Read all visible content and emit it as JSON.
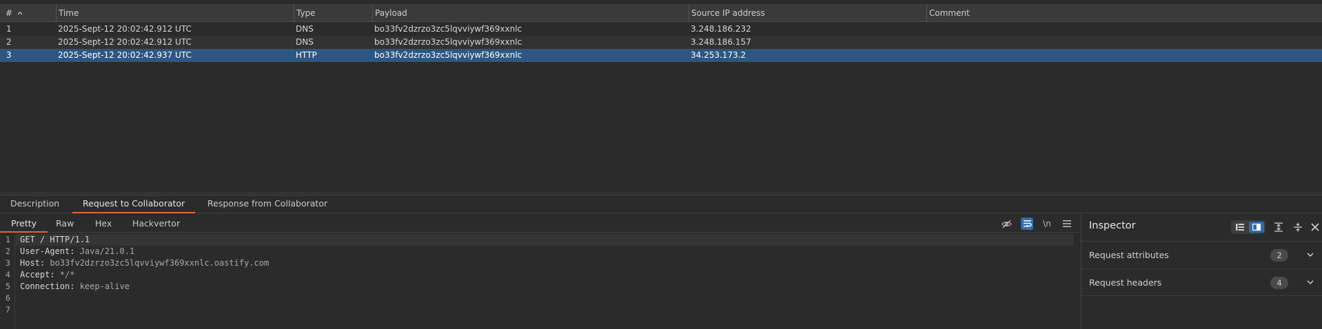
{
  "table": {
    "columns": [
      "#",
      "Time",
      "Type",
      "Payload",
      "Source IP address",
      "Comment"
    ],
    "rows": [
      {
        "num": "1",
        "time": "2025-Sept-12 20:02:42.912 UTC",
        "type": "DNS",
        "payload": "bo33fv2dzrzo3zc5lqvviywf369xxnlc",
        "ip": "3.248.186.232",
        "comment": ""
      },
      {
        "num": "2",
        "time": "2025-Sept-12 20:02:42.912 UTC",
        "type": "DNS",
        "payload": "bo33fv2dzrzo3zc5lqvviywf369xxnlc",
        "ip": "3.248.186.157",
        "comment": ""
      },
      {
        "num": "3",
        "time": "2025-Sept-12 20:02:42.937 UTC",
        "type": "HTTP",
        "payload": "bo33fv2dzrzo3zc5lqvviywf369xxnlc",
        "ip": "34.253.173.2",
        "comment": ""
      }
    ],
    "selected_row": "3"
  },
  "main_tabs": [
    "Description",
    "Request to Collaborator",
    "Response from Collaborator"
  ],
  "editor": {
    "tabs": [
      "Pretty",
      "Raw",
      "Hex",
      "Hackvertor"
    ],
    "newline_label": "\\n",
    "line_numbers": [
      "1",
      "2",
      "3",
      "4",
      "5",
      "6",
      "7"
    ],
    "lines": [
      {
        "key": "GET / HTTP/1.1",
        "value": ""
      },
      {
        "key": "User-Agent:",
        "value": " Java/21.0.1"
      },
      {
        "key": "Host:",
        "value": " bo33fv2dzrzo3zc5lqvviywf369xxnlc.oastify.com"
      },
      {
        "key": "Accept:",
        "value": " */*"
      },
      {
        "key": "Connection:",
        "value": " keep-alive"
      },
      {
        "key": "",
        "value": ""
      },
      {
        "key": "",
        "value": ""
      }
    ]
  },
  "inspector": {
    "title": "Inspector",
    "sections": [
      {
        "label": "Request attributes",
        "count": "2"
      },
      {
        "label": "Request headers",
        "count": "4"
      }
    ]
  },
  "colors": {
    "accent": "#e1683b",
    "selection": "#2d5782",
    "toggle_on": "#2d6db0"
  }
}
